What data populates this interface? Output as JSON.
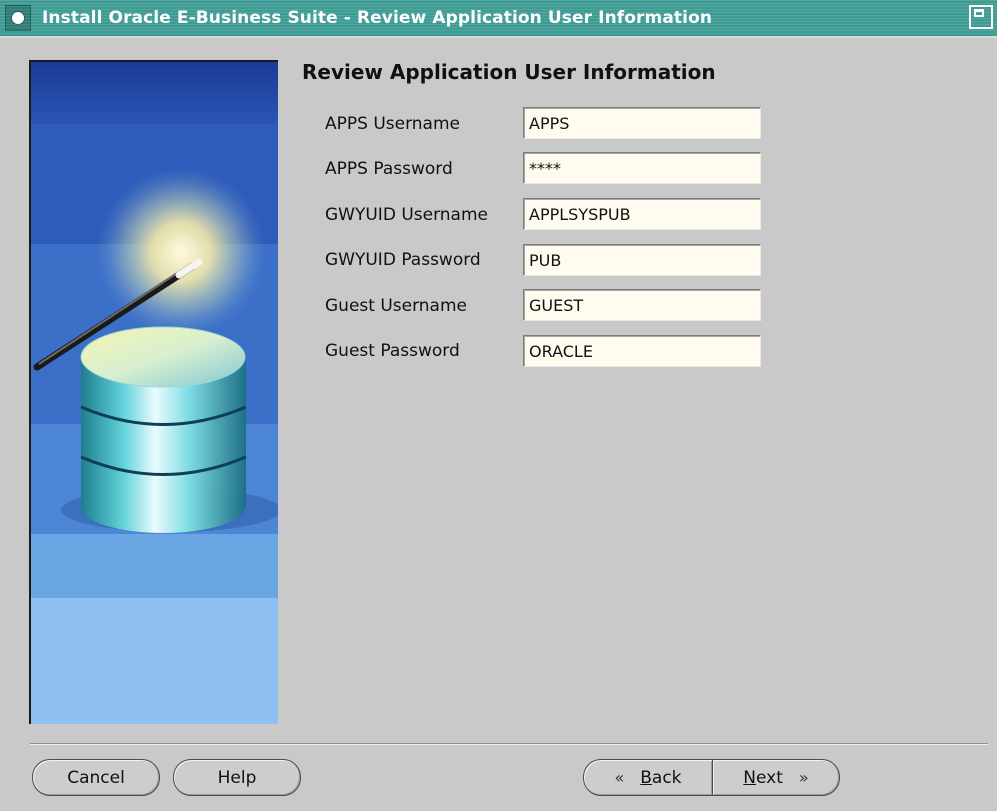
{
  "window": {
    "title": "Install Oracle E-Business Suite - Review Application User Information",
    "accent_color": "#3f9c95"
  },
  "page": {
    "heading": "Review Application User Information"
  },
  "form": {
    "fields": [
      {
        "label": "APPS Username",
        "value": "APPS"
      },
      {
        "label": "APPS Password",
        "value": "****"
      },
      {
        "label": "GWYUID Username",
        "value": "APPLSYSPUB"
      },
      {
        "label": "GWYUID Password",
        "value": "PUB"
      },
      {
        "label": "Guest Username",
        "value": "GUEST"
      },
      {
        "label": "Guest Password",
        "value": "ORACLE"
      }
    ]
  },
  "buttons": {
    "cancel": "Cancel",
    "help": "Help",
    "back_mnemonic": "B",
    "back_rest": "ack",
    "back_icon": "«",
    "next_mnemonic": "N",
    "next_rest": "ext",
    "next_icon": "»"
  },
  "icons": {
    "window_menu": "window-menu-icon",
    "maximize": "maximize-icon",
    "side_graphic": "database-wand-icon"
  }
}
